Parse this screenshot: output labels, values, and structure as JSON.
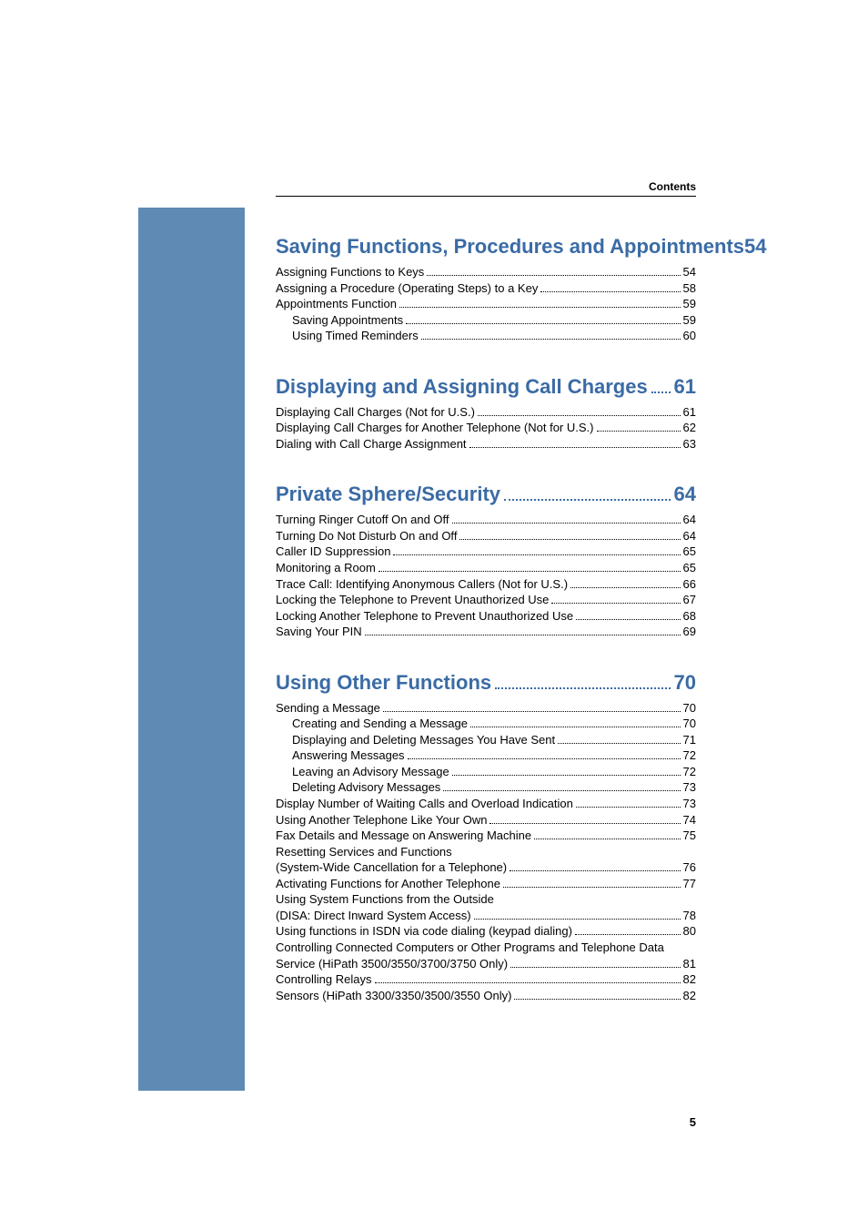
{
  "header": {
    "label": "Contents"
  },
  "pageNumber": "5",
  "sections": [
    {
      "title": "Saving Functions, Procedures and Appointments",
      "page": "54",
      "noDots": true,
      "entries": [
        {
          "text": "Assigning Functions to Keys",
          "page": "54",
          "indent": 0
        },
        {
          "text": "Assigning a Procedure (Operating Steps) to a Key",
          "page": "58",
          "indent": 0
        },
        {
          "text": "Appointments Function",
          "page": "59",
          "indent": 0
        },
        {
          "text": "Saving Appointments",
          "page": "59",
          "indent": 1
        },
        {
          "text": "Using Timed Reminders",
          "page": "60",
          "indent": 1
        }
      ]
    },
    {
      "title": "Displaying and Assigning Call Charges",
      "page": "61",
      "entries": [
        {
          "text": "Displaying Call Charges (Not for U.S.)",
          "page": "61",
          "indent": 0
        },
        {
          "text": "Displaying Call Charges for Another Telephone (Not for U.S.)",
          "page": "62",
          "indent": 0
        },
        {
          "text": "Dialing with Call Charge Assignment",
          "page": "63",
          "indent": 0
        }
      ]
    },
    {
      "title": "Private Sphere/Security",
      "page": "64",
      "entries": [
        {
          "text": "Turning Ringer Cutoff On and Off",
          "page": "64",
          "indent": 0
        },
        {
          "text": "Turning Do Not Disturb On and Off",
          "page": "64",
          "indent": 0
        },
        {
          "text": "Caller ID Suppression",
          "page": "65",
          "indent": 0
        },
        {
          "text": "Monitoring a Room",
          "page": "65",
          "indent": 0
        },
        {
          "text": "Trace Call: Identifying Anonymous Callers (Not for U.S.)",
          "page": "66",
          "indent": 0
        },
        {
          "text": "Locking the Telephone to Prevent Unauthorized Use",
          "page": "67",
          "indent": 0
        },
        {
          "text": "Locking Another Telephone to Prevent Unauthorized Use",
          "page": "68",
          "indent": 0
        },
        {
          "text": "Saving Your PIN",
          "page": "69",
          "indent": 0
        }
      ]
    },
    {
      "title": "Using Other Functions",
      "page": "70",
      "entries": [
        {
          "text": "Sending a Message",
          "page": "70",
          "indent": 0
        },
        {
          "text": "Creating and Sending a Message",
          "page": "70",
          "indent": 1
        },
        {
          "text": "Displaying and Deleting Messages You Have Sent",
          "page": "71",
          "indent": 1
        },
        {
          "text": "Answering Messages",
          "page": "72",
          "indent": 1
        },
        {
          "text": "Leaving an Advisory Message",
          "page": "72",
          "indent": 1
        },
        {
          "text": "Deleting Advisory Messages",
          "page": "73",
          "indent": 1
        },
        {
          "text": "Display Number of Waiting Calls and Overload Indication",
          "page": "73",
          "indent": 0
        },
        {
          "text": "Using Another Telephone Like Your Own",
          "page": "74",
          "indent": 0
        },
        {
          "text": "Fax Details and Message on Answering Machine",
          "page": "75",
          "indent": 0
        },
        {
          "text": "Resetting Services and Functions",
          "noPage": true,
          "indent": 0
        },
        {
          "text": "(System-Wide Cancellation for a Telephone)",
          "page": "76",
          "indent": 0
        },
        {
          "text": "Activating Functions for Another Telephone",
          "page": "77",
          "indent": 0
        },
        {
          "text": "Using System Functions from the Outside",
          "noPage": true,
          "indent": 0
        },
        {
          "text": "(DISA: Direct Inward System Access)",
          "page": "78",
          "indent": 0
        },
        {
          "text": "Using functions in ISDN via code dialing (keypad dialing)",
          "page": "80",
          "indent": 0
        },
        {
          "text": "Controlling Connected Computers or Other Programs and Telephone Data",
          "noPage": true,
          "indent": 0
        },
        {
          "text": "Service (HiPath 3500/3550/3700/3750 Only)",
          "page": "81",
          "indent": 0
        },
        {
          "text": "Controlling Relays",
          "page": "82",
          "indent": 0
        },
        {
          "text": "Sensors (HiPath 3300/3350/3500/3550 Only)",
          "page": "82",
          "indent": 0
        }
      ]
    }
  ]
}
